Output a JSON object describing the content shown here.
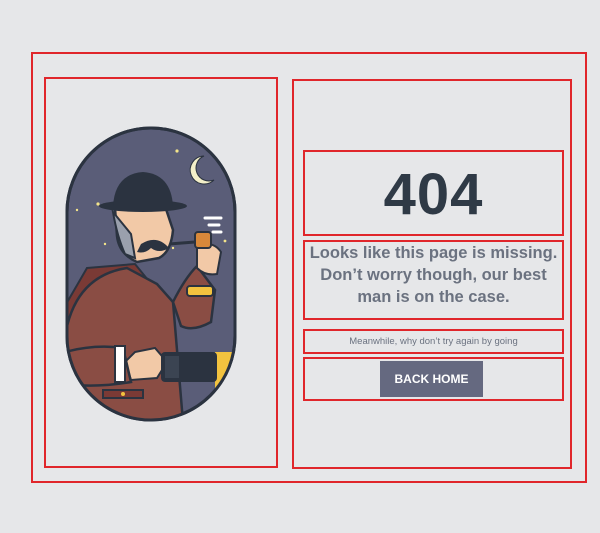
{
  "error": {
    "code": "404",
    "message": "Looks like this page is missing. Don’t worry though, our best man is on the case.",
    "sub_message": "Meanwhile, why don’t try again by going",
    "button_label": "BACK HOME"
  },
  "illustration": {
    "subject": "detective-with-pipe-and-flashlight",
    "icons": [
      "moon-icon",
      "star-icon",
      "smoke-icon"
    ]
  },
  "colors": {
    "background": "#e6e7e9",
    "heading": "#2f3a46",
    "body_text": "#6b7280",
    "button_bg": "#656980",
    "button_text": "#ffffff",
    "outline": "#e0262b",
    "night_sky": "#5a5d78"
  }
}
